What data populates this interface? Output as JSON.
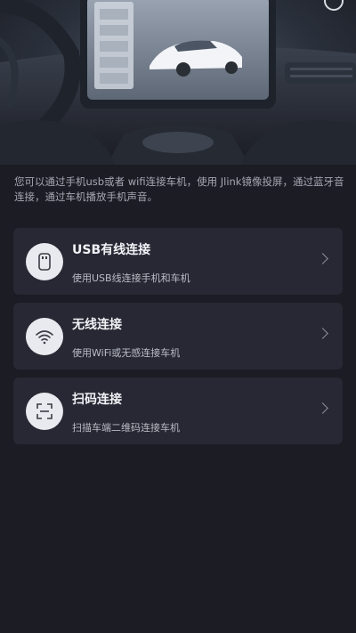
{
  "intro": {
    "text": "您可以通过手机usb或者 wifi连接车机，使用 Jlink镜像投屏，通过蓝牙音\n连接，通过车机播放手机声音。"
  },
  "options": [
    {
      "title": "USB有线连接",
      "subtitle": "使用USB线连接手机和车机",
      "icon": "usb-icon"
    },
    {
      "title": "无线连接",
      "subtitle": "使用WiFi或无感连接车机",
      "icon": "wifi-icon"
    },
    {
      "title": "扫码连接",
      "subtitle": "扫描车端二维码连接车机",
      "icon": "scan-icon"
    }
  ],
  "colors": {
    "background": "#1b1c24",
    "card": "#272833",
    "icon_bg": "#e9eaef"
  }
}
